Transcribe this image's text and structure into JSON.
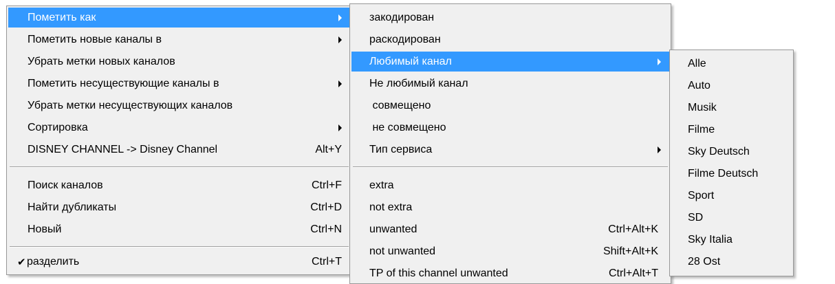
{
  "menu_main": {
    "items": [
      {
        "label": "Пометить как",
        "shortcut": ""
      },
      {
        "label": "Пометить новые каналы в",
        "shortcut": ""
      },
      {
        "label": "Убрать метки новых каналов",
        "shortcut": ""
      },
      {
        "label": "Пометить несуществующие каналы в",
        "shortcut": ""
      },
      {
        "label": "Убрать метки несуществующих каналов",
        "shortcut": ""
      },
      {
        "label": "Сортировка",
        "shortcut": ""
      },
      {
        "label": "DISNEY CHANNEL -> Disney Channel",
        "shortcut": "Alt+Y"
      },
      {
        "label": "Поиск каналов",
        "shortcut": "Ctrl+F"
      },
      {
        "label": "Найти дубликаты",
        "shortcut": "Ctrl+D"
      },
      {
        "label": "Новый",
        "shortcut": "Ctrl+N"
      },
      {
        "label": "разделить",
        "shortcut": "Ctrl+T",
        "check": "✔"
      }
    ]
  },
  "menu_mark_as": {
    "items": [
      {
        "label": "закодирован",
        "shortcut": ""
      },
      {
        "label": "раскодирован",
        "shortcut": ""
      },
      {
        "label": "Любимый канал",
        "shortcut": ""
      },
      {
        "label": "Не любимый канал",
        "shortcut": ""
      },
      {
        "label": " совмещено",
        "shortcut": ""
      },
      {
        "label": " не совмещено",
        "shortcut": ""
      },
      {
        "label": "Тип сервиса",
        "shortcut": ""
      },
      {
        "label": "extra",
        "shortcut": ""
      },
      {
        "label": "not extra",
        "shortcut": ""
      },
      {
        "label": "unwanted",
        "shortcut": "Ctrl+Alt+K"
      },
      {
        "label": "not unwanted",
        "shortcut": "Shift+Alt+K"
      },
      {
        "label": "TP of this channel unwanted",
        "shortcut": "Ctrl+Alt+T"
      }
    ]
  },
  "menu_favorites": {
    "items": [
      {
        "label": "Alle"
      },
      {
        "label": "Auto"
      },
      {
        "label": "Musik"
      },
      {
        "label": "Filme"
      },
      {
        "label": "Sky Deutsch"
      },
      {
        "label": "Filme Deutsch"
      },
      {
        "label": "Sport"
      },
      {
        "label": "SD"
      },
      {
        "label": "Sky Italia"
      },
      {
        "label": "28 Ost"
      }
    ]
  },
  "colors": {
    "highlight": "#3399ff",
    "menu_bg": "#f0f0f0",
    "border": "#979797"
  }
}
